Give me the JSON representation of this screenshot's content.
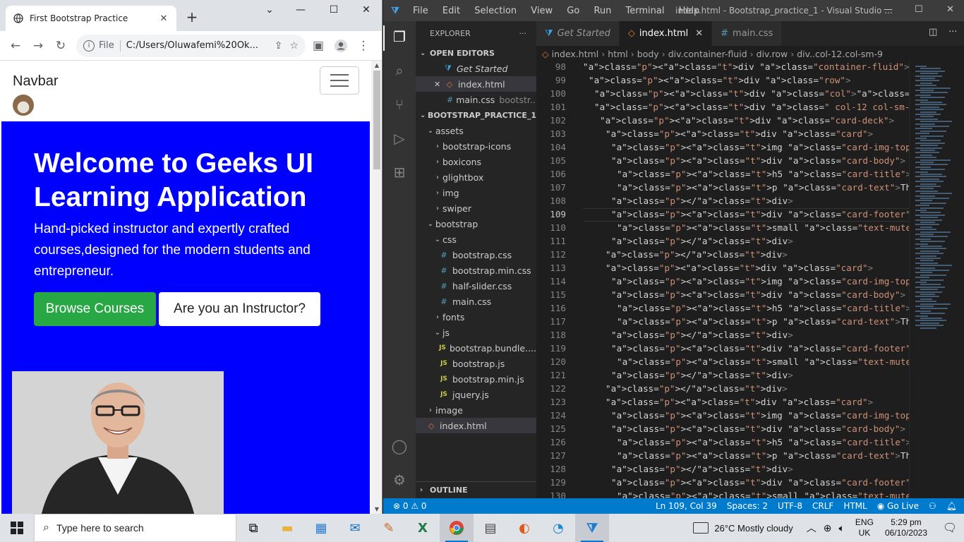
{
  "browser": {
    "tab_title": "First Bootstrap Practice",
    "address_file_label": "File",
    "address_url": "C:/Users/Oluwafemi%20Ok...",
    "page": {
      "brand": "Navbar",
      "hero_title": "Welcome to Geeks UI Learning Application",
      "hero_text": "Hand-picked instructor and expertly crafted courses,designed for the modern students and entrepreneur.",
      "btn_primary": "Browse Courses",
      "btn_secondary": "Are you an Instructor?"
    }
  },
  "vscode": {
    "menu": [
      "File",
      "Edit",
      "Selection",
      "View",
      "Go",
      "Run",
      "Terminal",
      "Help"
    ],
    "window_title": "index.html - Bootstrap_practice_1 - Visual Studio ...",
    "explorer_title": "EXPLORER",
    "open_editors_title": "OPEN EDITORS",
    "open_editors": [
      {
        "name": "Get Started",
        "note": ""
      },
      {
        "name": "index.html",
        "note": ""
      },
      {
        "name": "main.css",
        "note": "bootstr..."
      }
    ],
    "project_title": "BOOTSTRAP_PRACTICE_1",
    "tree": [
      {
        "name": "assets"
      },
      {
        "name": "bootstrap-icons"
      },
      {
        "name": "boxicons"
      },
      {
        "name": "glightbox"
      },
      {
        "name": "img"
      },
      {
        "name": "swiper"
      },
      {
        "name": "bootstrap"
      },
      {
        "name": "css"
      },
      {
        "name": "bootstrap.css"
      },
      {
        "name": "bootstrap.min.css"
      },
      {
        "name": "half-slider.css"
      },
      {
        "name": "main.css"
      },
      {
        "name": "fonts"
      },
      {
        "name": "js"
      },
      {
        "name": "bootstrap.bundle...."
      },
      {
        "name": "bootstrap.js"
      },
      {
        "name": "bootstrap.min.js"
      },
      {
        "name": "jquery.js"
      },
      {
        "name": "image"
      },
      {
        "name": "index.html"
      }
    ],
    "outline_title": "OUTLINE",
    "editor_tabs": [
      "Get Started",
      "index.html",
      "main.css"
    ],
    "breadcrumbs": [
      "index.html",
      "html",
      "body",
      "div.container-fluid",
      "div.row",
      "div..col-12.col-sm-9"
    ],
    "line_numbers": [
      "98",
      "99",
      "100",
      "101",
      "102",
      "103",
      "104",
      "105",
      "106",
      "107",
      "108",
      "109",
      "110",
      "111",
      "112",
      "113",
      "114",
      "115",
      "116",
      "117",
      "118",
      "119",
      "120",
      "121",
      "122",
      "123",
      "124",
      "125",
      "126",
      "127",
      "128",
      "129",
      "130"
    ],
    "status": {
      "problems": "⊗ 0 ⚠ 0",
      "position": "Ln 109, Col 39",
      "spaces": "Spaces: 2",
      "encoding": "UTF-8",
      "eol": "CRLF",
      "language": "HTML",
      "golive": "Go Live"
    }
  },
  "taskbar": {
    "search_placeholder": "Type here to search",
    "weather": "26°C  Mostly cloudy",
    "lang_top": "ENG",
    "lang_bottom": "UK",
    "time": "5:29 pm",
    "date": "06/10/2023"
  }
}
